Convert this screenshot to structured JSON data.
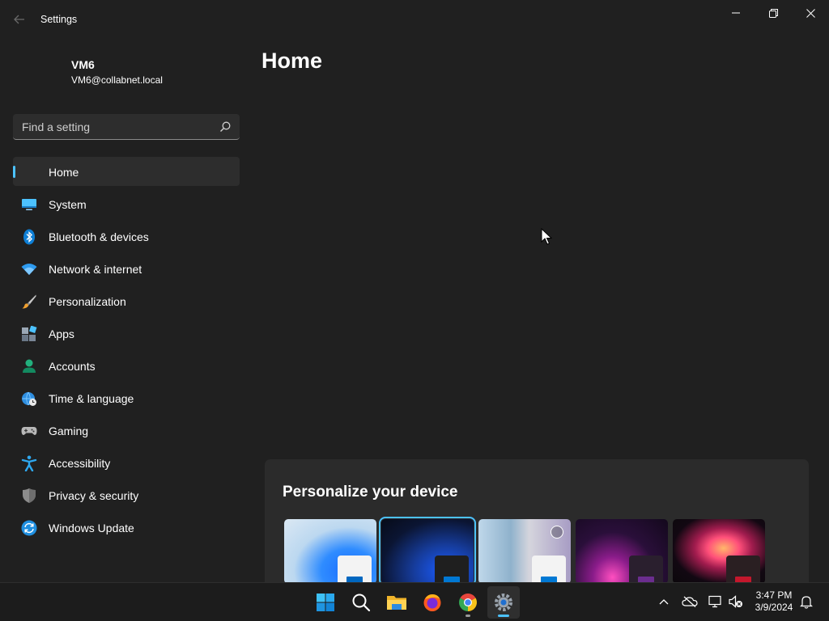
{
  "window": {
    "title": "Settings",
    "back_icon": "back-arrow-icon",
    "controls": [
      "minimize-icon",
      "restore-icon",
      "close-icon"
    ]
  },
  "profile": {
    "name": "VM6",
    "email": "VM6@collabnet.local"
  },
  "search": {
    "placeholder": "Find a setting",
    "value": "",
    "icon": "search-icon"
  },
  "nav": {
    "items": [
      {
        "label": "Home",
        "icon": "home-icon",
        "active": true
      },
      {
        "label": "System",
        "icon": "monitor-icon"
      },
      {
        "label": "Bluetooth & devices",
        "icon": "bluetooth-icon"
      },
      {
        "label": "Network & internet",
        "icon": "wifi-icon"
      },
      {
        "label": "Personalization",
        "icon": "paintbrush-icon"
      },
      {
        "label": "Apps",
        "icon": "apps-icon"
      },
      {
        "label": "Accounts",
        "icon": "person-icon"
      },
      {
        "label": "Time & language",
        "icon": "globe-clock-icon"
      },
      {
        "label": "Gaming",
        "icon": "gamepad-icon"
      },
      {
        "label": "Accessibility",
        "icon": "accessibility-icon"
      },
      {
        "label": "Privacy & security",
        "icon": "shield-icon"
      },
      {
        "label": "Windows Update",
        "icon": "update-icon"
      }
    ]
  },
  "main": {
    "title": "Home",
    "personalize_card": {
      "title": "Personalize your device",
      "themes": [
        {
          "name": "windows-light-theme",
          "selected": false
        },
        {
          "name": "windows-dark-theme",
          "selected": true
        },
        {
          "name": "windows-spotlight-theme",
          "selected": false
        },
        {
          "name": "glow-theme",
          "selected": false
        },
        {
          "name": "flower-theme",
          "selected": false
        }
      ]
    }
  },
  "taskbar": {
    "apps": [
      {
        "name": "start-icon"
      },
      {
        "name": "search-icon"
      },
      {
        "name": "file-explorer-icon"
      },
      {
        "name": "firefox-icon"
      },
      {
        "name": "chrome-icon",
        "running": true
      },
      {
        "name": "settings-icon",
        "running": true,
        "active": true
      }
    ],
    "tray": [
      "chevron-up-icon",
      "onedrive-offline-icon",
      "network-icon",
      "volume-muted-icon",
      "notification-bell-icon"
    ],
    "time": "3:47 PM",
    "date": "3/9/2024"
  },
  "colors": {
    "background": "#202020",
    "accent": "#4cc2ff",
    "card": "#2b2b2b",
    "taskbar": "#1c1c1c"
  }
}
